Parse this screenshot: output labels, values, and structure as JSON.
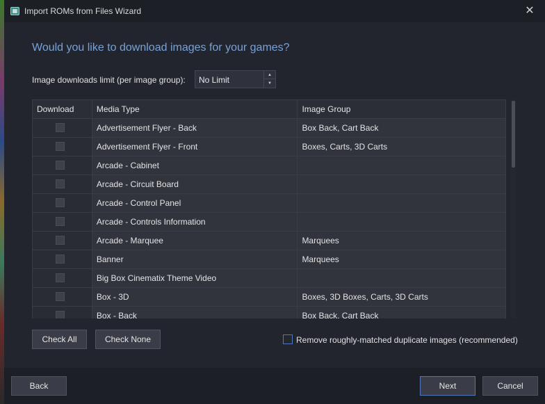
{
  "window": {
    "title": "Import ROMs from Files Wizard"
  },
  "heading": "Would you like to download images for your games?",
  "limit": {
    "label": "Image downloads limit (per image group):",
    "value": "No Limit"
  },
  "grid": {
    "columns": [
      "Download",
      "Media Type",
      "Image Group"
    ],
    "rows": [
      {
        "media_type": "Advertisement Flyer - Back",
        "image_group": "Box Back, Cart Back",
        "checked": false
      },
      {
        "media_type": "Advertisement Flyer - Front",
        "image_group": "Boxes, Carts, 3D Carts",
        "checked": false
      },
      {
        "media_type": "Arcade - Cabinet",
        "image_group": "",
        "checked": false
      },
      {
        "media_type": "Arcade - Circuit Board",
        "image_group": "",
        "checked": false
      },
      {
        "media_type": "Arcade - Control Panel",
        "image_group": "",
        "checked": false
      },
      {
        "media_type": "Arcade - Controls Information",
        "image_group": "",
        "checked": false
      },
      {
        "media_type": "Arcade - Marquee",
        "image_group": "Marquees",
        "checked": false
      },
      {
        "media_type": "Banner",
        "image_group": "Marquees",
        "checked": false
      },
      {
        "media_type": "Big Box Cinematix Theme Video",
        "image_group": "",
        "checked": false
      },
      {
        "media_type": "Box - 3D",
        "image_group": "Boxes, 3D Boxes, Carts, 3D Carts",
        "checked": false
      },
      {
        "media_type": "Box - Back",
        "image_group": "Box Back, Cart Back",
        "checked": false
      }
    ]
  },
  "buttons": {
    "check_all": "Check All",
    "check_none": "Check None",
    "back": "Back",
    "next": "Next",
    "cancel": "Cancel"
  },
  "duplicate_option": {
    "label": "Remove roughly-matched duplicate images (recommended)",
    "checked": false
  },
  "icons": {
    "close": "close-icon",
    "app": "app-icon"
  }
}
